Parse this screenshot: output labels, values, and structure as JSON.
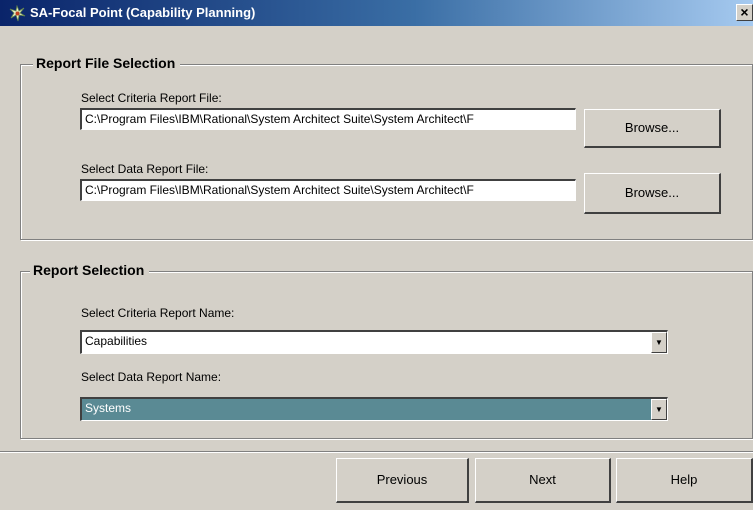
{
  "window": {
    "title": "SA-Focal Point (Capability Planning)",
    "close_label": "×",
    "app_icon": "sa-focal-point-icon"
  },
  "report_file_selection": {
    "legend": "Report File Selection",
    "criteria_file_label": "Select Criteria Report File:",
    "criteria_file_value": "C:\\Program Files\\IBM\\Rational\\System Architect Suite\\System Architect\\F",
    "criteria_browse_label": "Browse...",
    "data_file_label": "Select Data Report File:",
    "data_file_value": "C:\\Program Files\\IBM\\Rational\\System Architect Suite\\System Architect\\F",
    "data_browse_label": "Browse..."
  },
  "report_selection": {
    "legend": "Report Selection",
    "criteria_name_label": "Select Criteria Report Name:",
    "criteria_name_value": "Capabilities",
    "data_name_label": "Select Data Report Name:",
    "data_name_value": "Systems"
  },
  "footer": {
    "previous_label": "Previous",
    "next_label": "Next",
    "help_label": "Help"
  },
  "colors": {
    "face": "#d4d0c8",
    "titlebar_start": "#0a246a",
    "titlebar_end": "#a6caf0",
    "selected_combo": "#5a8a94"
  }
}
